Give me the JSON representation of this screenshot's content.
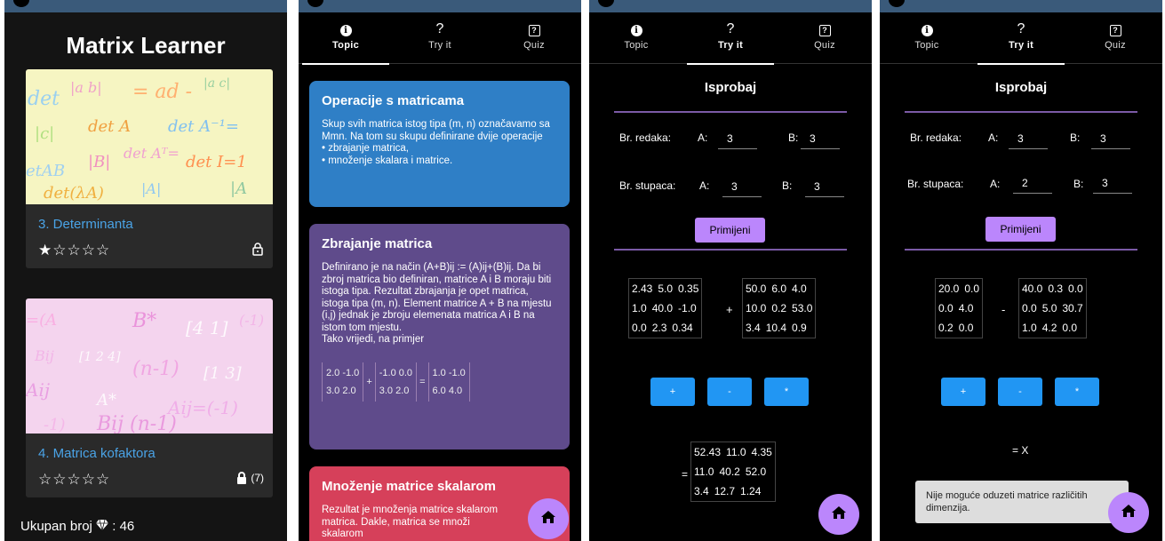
{
  "screen1": {
    "title": "Matrix Learner",
    "cards": [
      {
        "title": "3. Determinanta",
        "stars": "★☆☆☆☆",
        "lock_count": ""
      },
      {
        "title": "4. Matrica kofaktora",
        "stars": "☆☆☆☆☆",
        "lock_count": "(7)"
      }
    ],
    "total_label": "Ukupan broj",
    "total_value": ": 46"
  },
  "tabs": {
    "topic": "Topic",
    "try": "Try it",
    "quiz": "Quiz"
  },
  "screen2": {
    "cards": [
      {
        "title": "Operacije s matricama",
        "body": "Skup svih matrica istog tipa (m, n) označavamo sa Mmn. Na tom su skupu definirane dvije operacije\n• zbrajanje matrica,\n• množenje skalara i matrice.",
        "color": "#2f7fc6"
      },
      {
        "title": "Zbrajanje matrica",
        "body": "Definirano je na način (A+B)ij := (A)ij+(B)ij. Da bi zbroj matrica bio definiran, matrice A i B moraju biti istoga tipa. Rezultat zbrajanja je opet matrica, istoga tipa (m, n). Element matrice A + B na mjestu (i,j) jednak je zbroju elemenata matrica A i B na istom tom mjestu.\nTako vrijedi, na primjer",
        "color": "#5f4b8b",
        "example": {
          "a": [
            "2.0 -1.0",
            "3.0  2.0"
          ],
          "b": [
            "-1.0 0.0",
            "3.0  2.0"
          ],
          "c": [
            "1.0 -1.0",
            "6.0  4.0"
          ],
          "plus": "+",
          "eq": "="
        }
      },
      {
        "title": "Množenje matrice skalarom",
        "body": "Rezultat je množenja matrice skalarom matrica. Dakle, matrica se množi skalarom",
        "color": "#d6405a"
      }
    ]
  },
  "screen3": {
    "title": "Isprobaj",
    "rows_label": "Br. redaka:",
    "cols_label": "Br. stupaca:",
    "a_label": "A:",
    "b_label": "B:",
    "rows_a": "3",
    "rows_b": "3",
    "cols_a": "3",
    "cols_b": "3",
    "apply": "Primijeni",
    "matrix_a": [
      [
        "2.43",
        "5.0",
        "0.35"
      ],
      [
        "1.0",
        "40.0",
        "-1.0"
      ],
      [
        "0.0",
        "2.3",
        "0.34"
      ]
    ],
    "matrix_b": [
      [
        "50.0",
        "6.0",
        "4.0"
      ],
      [
        "10.0",
        "0.2",
        "53.0"
      ],
      [
        "3.4",
        "10.4",
        "0.9"
      ]
    ],
    "op": "+",
    "buttons": [
      "+",
      "-",
      "*"
    ],
    "eq": "=",
    "result": [
      [
        "52.43",
        "11.0",
        "4.35"
      ],
      [
        "11.0",
        "40.2",
        "52.0"
      ],
      [
        "3.4",
        "12.7",
        "1.24"
      ]
    ]
  },
  "screen4": {
    "title": "Isprobaj",
    "rows_label": "Br. redaka:",
    "cols_label": "Br. stupaca:",
    "a_label": "A:",
    "b_label": "B:",
    "rows_a": "3",
    "rows_b": "3",
    "cols_a": "2",
    "cols_b": "3",
    "apply": "Primijeni",
    "matrix_a": [
      [
        "20.0",
        "0.0"
      ],
      [
        "0.0",
        "4.0"
      ],
      [
        "0.2",
        "0.0"
      ]
    ],
    "matrix_b": [
      [
        "40.0",
        "0.3",
        "0.0"
      ],
      [
        "0.0",
        "5.0",
        "30.7"
      ],
      [
        "1.0",
        "4.2",
        "0.0"
      ]
    ],
    "op": "-",
    "buttons": [
      "+",
      "-",
      "*"
    ],
    "result_text": "= X",
    "toast": "Nije moguće oduzeti matrice različitih dimenzija."
  },
  "colors": {
    "accent": "#bb86fc",
    "button": "#2196f3",
    "link": "#4aa3e6"
  },
  "icons": [
    "info-icon",
    "question-icon",
    "quiz-icon",
    "home-icon",
    "lock-icon",
    "diamond-icon"
  ]
}
